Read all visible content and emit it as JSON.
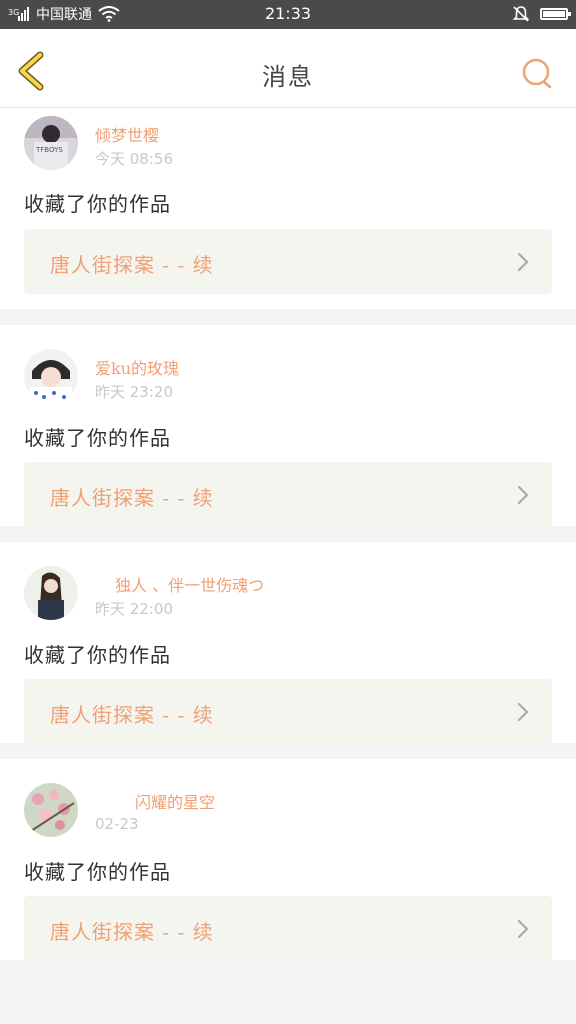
{
  "status_bar": {
    "carrier": "中国联通",
    "time": "21:33"
  },
  "header": {
    "title": "消息",
    "back_icon": "chevron-left-icon",
    "search_icon": "search-icon",
    "accent_color": "#f0a074"
  },
  "messages": [
    {
      "username": "倾梦世樱",
      "time": "今天 08:56",
      "action": "收藏了你的作品",
      "work_title": "唐人街探案 - - 续"
    },
    {
      "username": "爱ku的玫瑰",
      "time": "昨天 23:20",
      "action": "收藏了你的作品",
      "work_title": "唐人街探案 - - 续"
    },
    {
      "username": "独人 、伴一世伤魂つ",
      "time": "昨天 22:00",
      "action": "收藏了你的作品",
      "work_title": "唐人街探案 - - 续"
    },
    {
      "username": "闪耀的星空",
      "time": "02-23",
      "action": "收藏了你的作品",
      "work_title": "唐人街探案 - - 续"
    }
  ]
}
